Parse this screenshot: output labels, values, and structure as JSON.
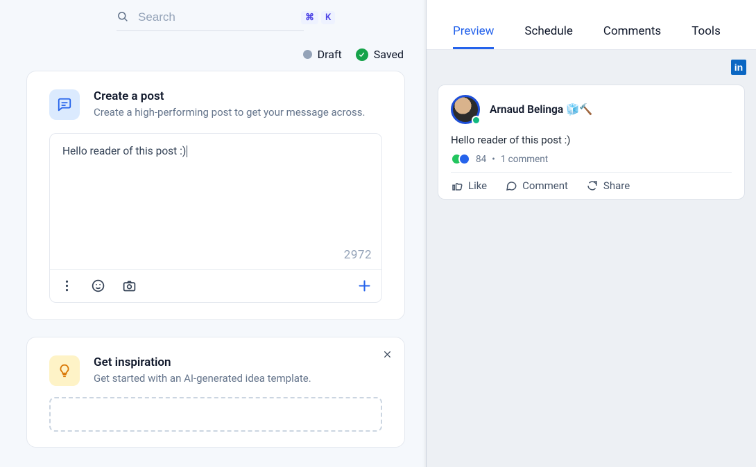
{
  "search": {
    "placeholder": "Search",
    "shortcut": [
      "⌘",
      "K"
    ]
  },
  "status": {
    "draft": "Draft",
    "saved": "Saved"
  },
  "create": {
    "title": "Create a post",
    "subtitle": "Create a high-performing post to get your message across.",
    "content": "Hello reader of this post :)",
    "counter": "2972"
  },
  "inspire": {
    "title": "Get inspiration",
    "subtitle": "Get started with an AI-generated idea template."
  },
  "tabs": [
    "Preview",
    "Schedule",
    "Comments",
    "Tools"
  ],
  "activeTab": 0,
  "preview": {
    "author": "Arnaud Belinga 🧊🔨",
    "body": "Hello reader of this post :)",
    "likes": "84",
    "comments_text": "1 comment",
    "actions": {
      "like": "Like",
      "comment": "Comment",
      "share": "Share"
    }
  }
}
